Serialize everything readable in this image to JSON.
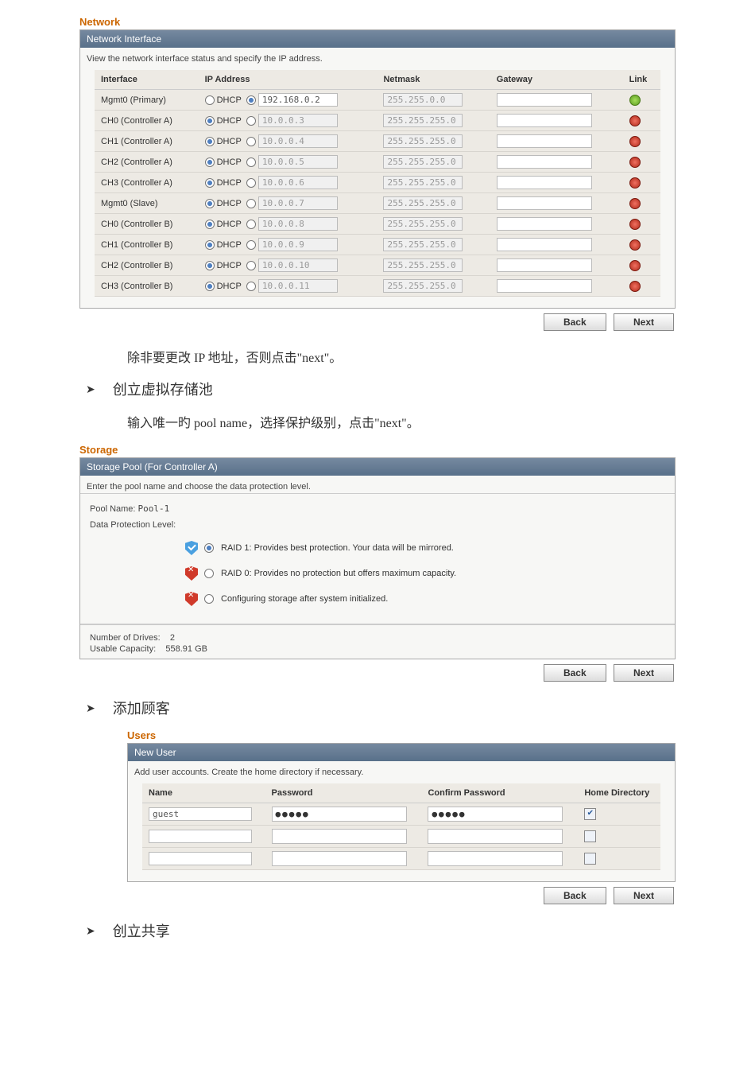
{
  "network": {
    "heading": "Network",
    "titlebar": "Network Interface",
    "subtext": "View the network interface status and specify the IP address.",
    "columns": {
      "iface": "Interface",
      "ip": "IP Address",
      "mask": "Netmask",
      "gw": "Gateway",
      "link": "Link"
    },
    "rows": [
      {
        "iface": "Mgmt0 (Primary)",
        "dhcp_sel": false,
        "static_sel": true,
        "ip": "192.168.0.2",
        "ip_disabled": false,
        "mask": "255.255.0.0",
        "link": "green"
      },
      {
        "iface": "CH0 (Controller A)",
        "dhcp_sel": true,
        "static_sel": false,
        "ip": "10.0.0.3",
        "ip_disabled": true,
        "mask": "255.255.255.0",
        "link": "red"
      },
      {
        "iface": "CH1 (Controller A)",
        "dhcp_sel": true,
        "static_sel": false,
        "ip": "10.0.0.4",
        "ip_disabled": true,
        "mask": "255.255.255.0",
        "link": "red"
      },
      {
        "iface": "CH2 (Controller A)",
        "dhcp_sel": true,
        "static_sel": false,
        "ip": "10.0.0.5",
        "ip_disabled": true,
        "mask": "255.255.255.0",
        "link": "red"
      },
      {
        "iface": "CH3 (Controller A)",
        "dhcp_sel": true,
        "static_sel": false,
        "ip": "10.0.0.6",
        "ip_disabled": true,
        "mask": "255.255.255.0",
        "link": "red"
      },
      {
        "iface": "Mgmt0 (Slave)",
        "dhcp_sel": true,
        "static_sel": false,
        "ip": "10.0.0.7",
        "ip_disabled": true,
        "mask": "255.255.255.0",
        "link": "red"
      },
      {
        "iface": "CH0 (Controller B)",
        "dhcp_sel": true,
        "static_sel": false,
        "ip": "10.0.0.8",
        "ip_disabled": true,
        "mask": "255.255.255.0",
        "link": "red"
      },
      {
        "iface": "CH1 (Controller B)",
        "dhcp_sel": true,
        "static_sel": false,
        "ip": "10.0.0.9",
        "ip_disabled": true,
        "mask": "255.255.255.0",
        "link": "red"
      },
      {
        "iface": "CH2 (Controller B)",
        "dhcp_sel": true,
        "static_sel": false,
        "ip": "10.0.0.10",
        "ip_disabled": true,
        "mask": "255.255.255.0",
        "link": "red"
      },
      {
        "iface": "CH3 (Controller B)",
        "dhcp_sel": true,
        "static_sel": false,
        "ip": "10.0.0.11",
        "ip_disabled": true,
        "mask": "255.255.255.0",
        "link": "red"
      }
    ],
    "dhcp_label": "DHCP"
  },
  "buttons": {
    "back": "Back",
    "next": "Next"
  },
  "doc": {
    "line1": "除非要更改 IP 地址，否则点击\"next\"。",
    "bullet1": "创立虚拟存储池",
    "line2": "输入唯一旳 pool name，选择保护级别，点击\"next\"。",
    "bullet2": "添加顾客",
    "bullet3": "创立共享"
  },
  "storage": {
    "heading": "Storage",
    "titlebar": "Storage Pool (For Controller A)",
    "subtext": "Enter the pool name and choose the data protection level.",
    "pool_label": "Pool Name:",
    "pool_value": "Pool-1",
    "level_label": "Data Protection Level:",
    "opt1": "RAID 1: Provides best protection. Your data will be mirrored.",
    "opt2": "RAID 0: Provides no protection but offers maximum capacity.",
    "opt3": "Configuring storage after system initialized.",
    "drives_label": "Number of Drives:",
    "drives_value": "2",
    "capacity_label": "Usable Capacity:",
    "capacity_value": "558.91 GB"
  },
  "users": {
    "heading": "Users",
    "titlebar": "New User",
    "subtext": "Add user accounts. Create the home directory if necessary.",
    "columns": {
      "name": "Name",
      "pw": "Password",
      "cpw": "Confirm Password",
      "home": "Home Directory"
    },
    "rows": [
      {
        "name": "guest",
        "pw": "●●●●●",
        "cpw": "●●●●●",
        "home": true
      },
      {
        "name": "",
        "pw": "",
        "cpw": "",
        "home": false
      },
      {
        "name": "",
        "pw": "",
        "cpw": "",
        "home": false
      }
    ]
  }
}
